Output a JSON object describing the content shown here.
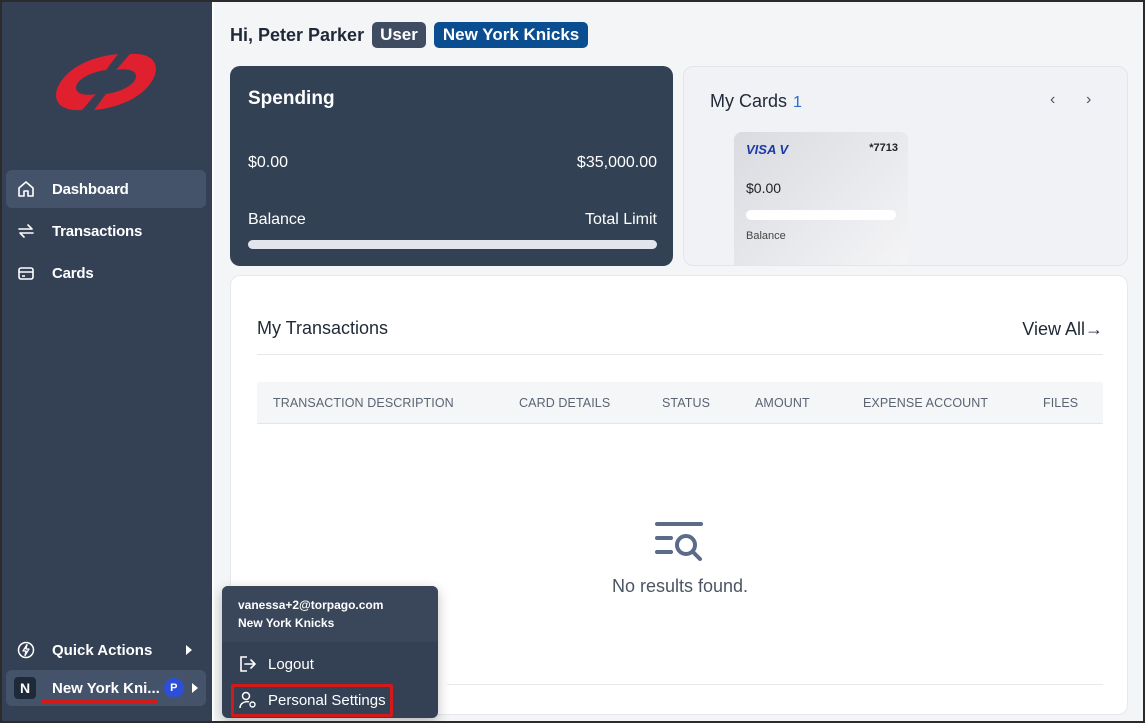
{
  "sidebar": {
    "logo": "brand-logo",
    "items": [
      {
        "label": "Dashboard",
        "icon": "home-icon",
        "active": true
      },
      {
        "label": "Transactions",
        "icon": "transfer-icon",
        "active": false
      },
      {
        "label": "Cards",
        "icon": "card-icon",
        "active": false
      }
    ],
    "quick_actions": {
      "label": "Quick Actions",
      "icon": "lightning-icon"
    },
    "org": {
      "initial": "N",
      "label": "New York Kni...",
      "badge": "P"
    }
  },
  "header": {
    "greeting": "Hi, Peter Parker",
    "role_badge": "User",
    "org_badge": "New York Knicks"
  },
  "spending": {
    "title": "Spending",
    "amount": "$0.00",
    "total": "$35,000.00",
    "balance_label": "Balance",
    "limit_label": "Total Limit",
    "progress": 0
  },
  "my_cards": {
    "title": "My Cards",
    "count": "1",
    "prev": "‹",
    "next": "›",
    "card": {
      "brand": "VISA V",
      "number": "*7713",
      "amount": "$0.00",
      "balance_label": "Balance"
    }
  },
  "transactions": {
    "title": "My Transactions",
    "view_all": "View All→",
    "columns": [
      "TRANSACTION DESCRIPTION",
      "CARD DETAILS",
      "STATUS",
      "AMOUNT",
      "EXPENSE ACCOUNT",
      "FILES"
    ],
    "empty_text": "No results found."
  },
  "popup": {
    "email": "vanessa+2@torpago.com",
    "org": "New York Knicks",
    "logout": "Logout",
    "personal_settings": "Personal Settings"
  },
  "colors": {
    "sidebar": "#344154",
    "spend_card": "#334155",
    "org_badge": "#0b4d91",
    "user_badge": "#3f4c61",
    "highlight": "#d31a1a",
    "brand_red": "#e0202e"
  }
}
